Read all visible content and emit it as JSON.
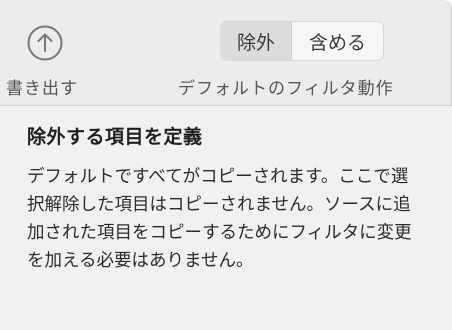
{
  "toolbar": {
    "export_label": "書き出す",
    "segmented": {
      "options": [
        "除外",
        "含める"
      ],
      "selected": "除外"
    },
    "default_filter_label": "デフォルトのフィルタ動作"
  },
  "tooltip": {
    "title": "除外する項目を定義",
    "body": "デフォルトですべてがコピーされます。ここで選択解除した項目はコピーされません。ソースに追加された項目をコピーするためにフィルタに変更を加える必要はありません。"
  },
  "icons": {
    "export": "arrow-up-circle-icon"
  }
}
